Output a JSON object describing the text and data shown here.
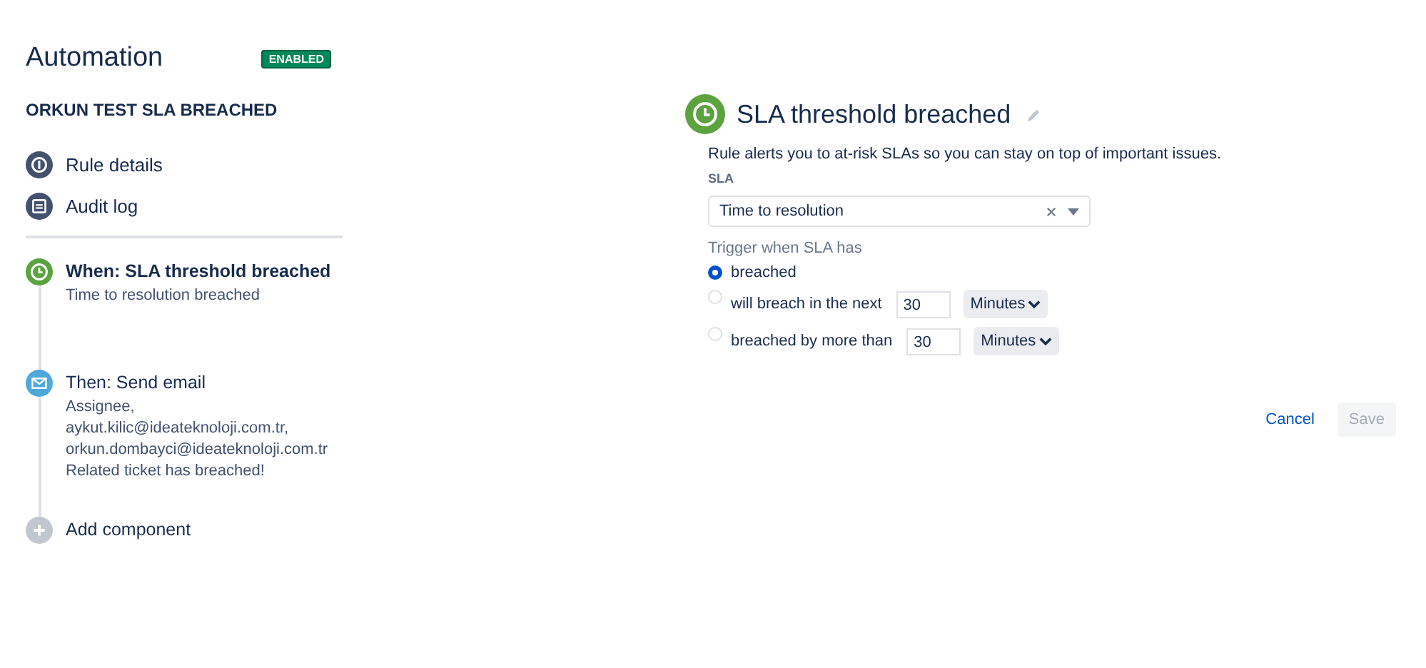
{
  "header": {
    "title": "Automation",
    "status": "ENABLED"
  },
  "rule_name": "ORKUN TEST SLA BREACHED",
  "nav": [
    {
      "label": "Rule details",
      "kind": "info"
    },
    {
      "label": "Audit log",
      "kind": "log"
    }
  ],
  "steps": [
    {
      "kind": "trigger",
      "title": "When: SLA threshold breached",
      "selected": true,
      "details": [
        "Time to resolution breached"
      ]
    },
    {
      "kind": "action",
      "title": "Then: Send email",
      "selected": false,
      "details": [
        "Assignee,",
        "aykut.kilic@ideateknoloji.com.tr,",
        "orkun.dombayci@ideateknoloji.com.tr",
        "Related ticket has breached!"
      ]
    },
    {
      "kind": "add",
      "title": "Add component",
      "selected": false
    }
  ],
  "panel": {
    "title": "SLA threshold breached",
    "description": "Rule alerts you to at-risk SLAs so you can stay on top of important issues.",
    "sla_label": "SLA",
    "sla_value": "Time to resolution",
    "trigger_label": "Trigger when SLA has",
    "options": [
      {
        "kind": "plain",
        "label": "breached",
        "selected": true
      },
      {
        "kind": "time",
        "label": "will breach in the next",
        "selected": false,
        "value": "30",
        "unit": "Minutes"
      },
      {
        "kind": "time",
        "label": "breached by more than",
        "selected": false,
        "value": "30",
        "unit": "Minutes"
      }
    ],
    "buttons": [
      {
        "kind": "link",
        "label": "Cancel",
        "disabled": false
      },
      {
        "kind": "primary",
        "label": "Save",
        "disabled": true
      }
    ]
  }
}
